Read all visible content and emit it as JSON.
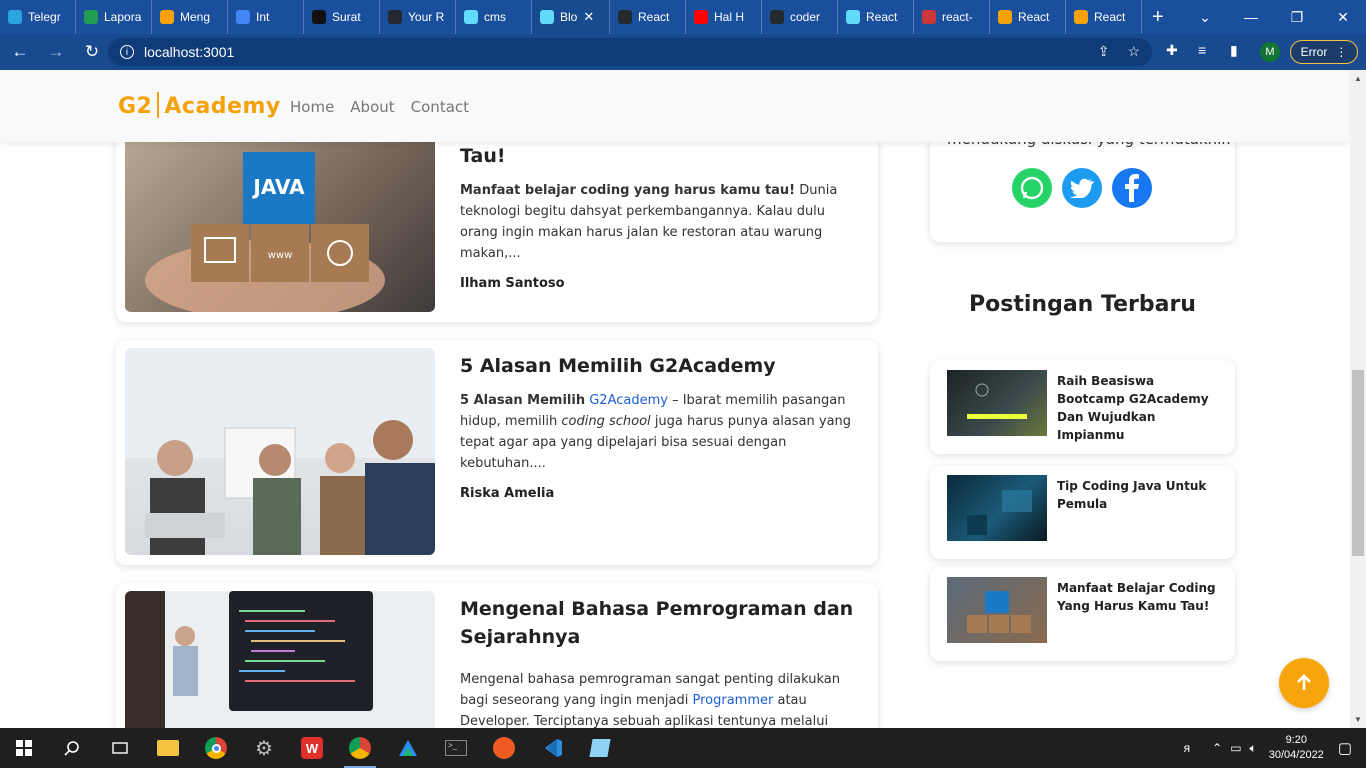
{
  "browser": {
    "tabs": [
      {
        "label": "Telegr",
        "fav": "#2aa3e0"
      },
      {
        "label": "Lapora",
        "fav": "#1f9d55"
      },
      {
        "label": "Meng",
        "fav": "#f5a10a"
      },
      {
        "label": "Int",
        "fav": "#4285f4"
      },
      {
        "label": "Surat",
        "fav": "#111111"
      },
      {
        "label": "Your R",
        "fav": "#24292f"
      },
      {
        "label": "cms",
        "fav": "#61dafb"
      },
      {
        "label": "Blo",
        "fav": "#61dafb",
        "active": true
      },
      {
        "label": "React",
        "fav": "#24292f"
      },
      {
        "label": "Hal H",
        "fav": "#ff0000"
      },
      {
        "label": "coder",
        "fav": "#24292f"
      },
      {
        "label": "React",
        "fav": "#61dafb"
      },
      {
        "label": "react-",
        "fav": "#cb3837"
      },
      {
        "label": "React",
        "fav": "#f5a10a"
      },
      {
        "label": "React",
        "fav": "#f5a10a"
      }
    ],
    "url": "localhost:3001",
    "error_label": "Error",
    "profile_initial": "M"
  },
  "navbar": {
    "logo_left": "G2",
    "logo_right": "Academy",
    "links": [
      "Home",
      "About",
      "Contact"
    ]
  },
  "posts": [
    {
      "title_tail": "Tau!",
      "excerpt_bold": "Manfaat belajar coding yang harus kamu tau!",
      "excerpt": " Dunia teknologi begitu dahsyat perkembangannya. Kalau dulu orang ingin makan harus jalan ke restoran atau warung makan,...",
      "author": "Ilham Santoso",
      "image_label": "JAVA"
    },
    {
      "title": "5 Alasan Memilih G2Academy",
      "excerpt_bold": "5 Alasan Memilih",
      "excerpt_link": "G2Academy",
      "excerpt_pre_italic": " – Ibarat memilih pasangan hidup, memilih ",
      "excerpt_italic": "coding school",
      "excerpt_post": " juga harus punya alasan yang tepat agar apa yang dipelajari bisa sesuai dengan kebutuhan....",
      "author": "Riska Amelia"
    },
    {
      "title": "Mengenal Bahasa Pemrograman dan Sejarahnya",
      "excerpt_pre": "Mengenal bahasa pemrograman sangat penting dilakukan bagi seseorang yang ingin menjadi ",
      "excerpt_link": "Programmer",
      "excerpt_post": " atau Developer. Terciptanya sebuah aplikasi tentunya melalui bahasa..."
    }
  ],
  "sidebar": {
    "share_text": "mendukung diskusi yang termutakhir.",
    "social": [
      "whatsapp-icon",
      "twitter-icon",
      "facebook-icon"
    ],
    "recent_title": "Postingan Terbaru",
    "recent": [
      {
        "title": "Raih Beasiswa Bootcamp G2Academy Dan Wujudkan Impianmu"
      },
      {
        "title": "Tip Coding Java Untuk Pemula"
      },
      {
        "title": "Manfaat Belajar Coding Yang Harus Kamu Tau!"
      }
    ]
  },
  "taskbar": {
    "time": "9:20",
    "date": "30/04/2022"
  }
}
